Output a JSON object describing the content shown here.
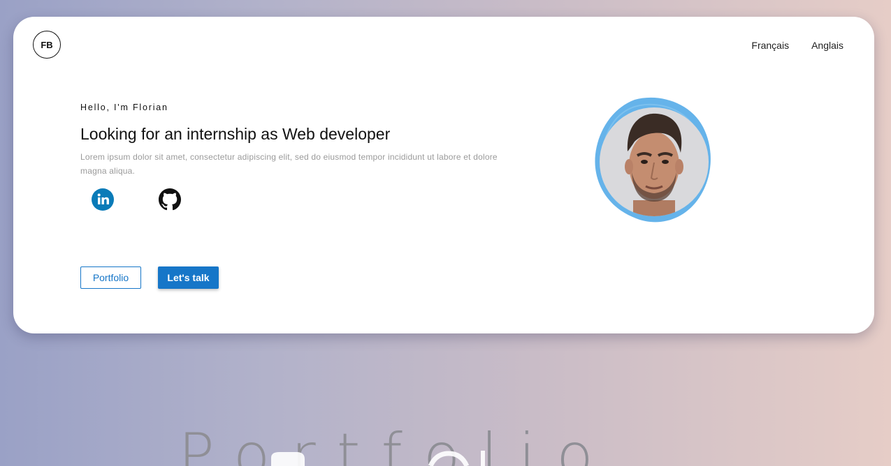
{
  "header": {
    "logo_text": "FB",
    "languages": [
      "Français",
      "Anglais"
    ]
  },
  "hero": {
    "greeting": "Hello, I'm Florian",
    "headline": "Looking for an internship as Web developer",
    "description": "Lorem ipsum dolor sit amet, consectetur adipiscing elit, sed do eiusmod tempor incididunt ut labore et dolore magna aliqua.",
    "socials": [
      {
        "name": "linkedin",
        "icon": "linkedin-icon",
        "color": "#0a7bb8"
      },
      {
        "name": "github",
        "icon": "github-icon",
        "color": "#111111"
      }
    ],
    "buttons": {
      "portfolio": "Portfolio",
      "talk": "Let's talk"
    },
    "accent_color": "#1676c8",
    "avatar_blob_color": "#4aa6e6"
  },
  "section": {
    "title": "Portfolio"
  }
}
